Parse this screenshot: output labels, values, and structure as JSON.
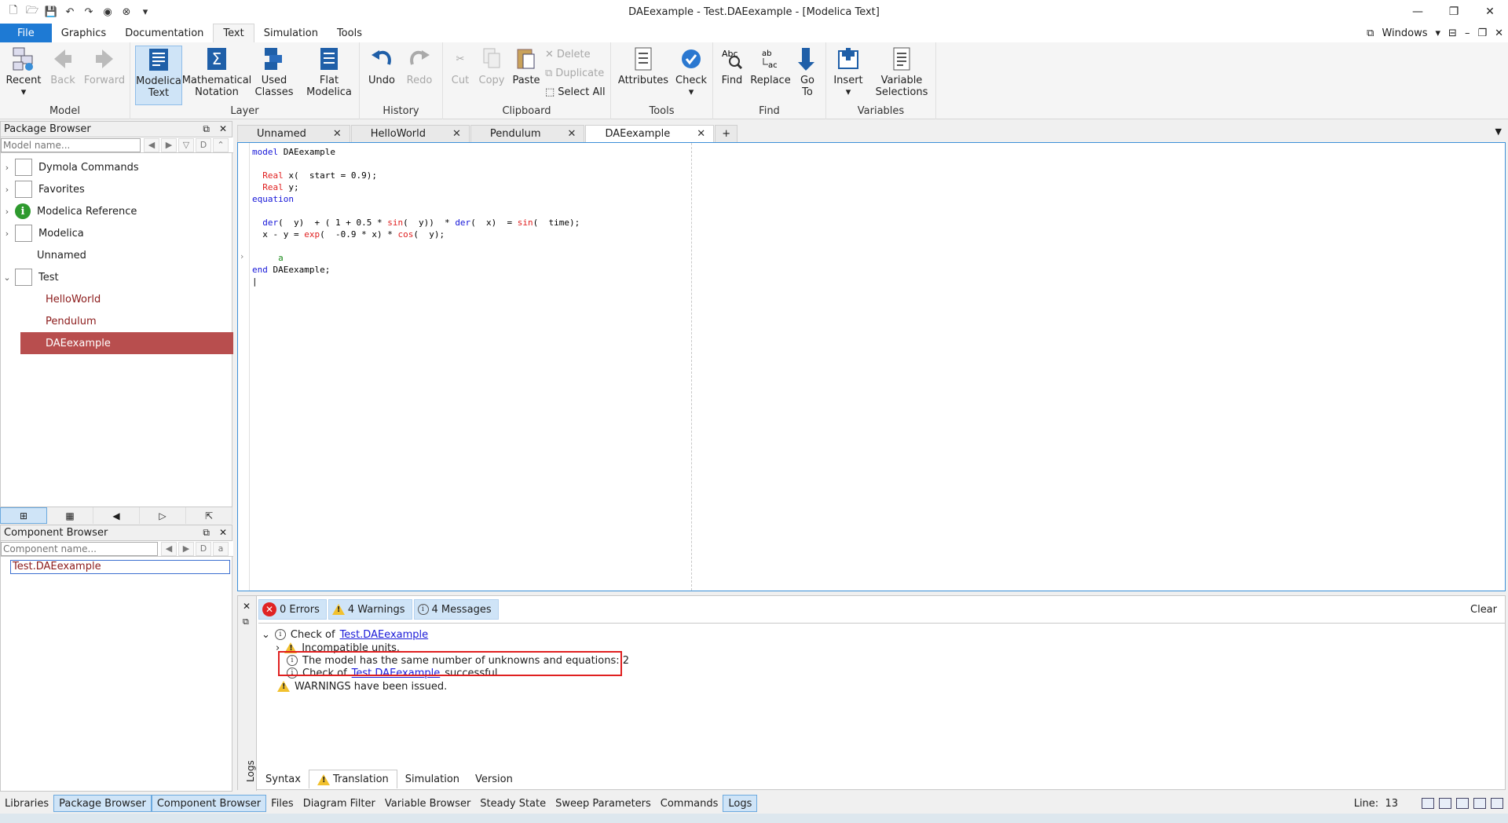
{
  "window": {
    "title": "DAEexample - Test.DAEexample  - [Modelica Text]"
  },
  "ribbon_tabs": [
    "File",
    "Graphics",
    "Documentation",
    "Text",
    "Simulation",
    "Tools"
  ],
  "windows_menu": "Windows",
  "ribbon": {
    "model": {
      "label": "Model",
      "recent": "Recent",
      "back": "Back",
      "forward": "Forward"
    },
    "layer": {
      "label": "Layer",
      "modelica_text": "Modelica\nText",
      "math_notation": "Mathematical\nNotation",
      "used_classes": "Used\nClasses",
      "flat_modelica": "Flat\nModelica"
    },
    "history": {
      "label": "History",
      "undo": "Undo",
      "redo": "Redo"
    },
    "clipboard": {
      "label": "Clipboard",
      "cut": "Cut",
      "copy": "Copy",
      "paste": "Paste",
      "delete": "Delete",
      "duplicate": "Duplicate",
      "select_all": "Select All"
    },
    "tools": {
      "label": "Tools",
      "attributes": "Attributes",
      "check": "Check"
    },
    "find": {
      "label": "Find",
      "find": "Find",
      "replace": "Replace",
      "goto": "Go\nTo"
    },
    "variables": {
      "label": "Variables",
      "insert": "Insert",
      "variable_selections": "Variable\nSelections"
    }
  },
  "package_browser": {
    "title": "Package Browser",
    "search_placeholder": "Model name...",
    "items": [
      {
        "label": "Dymola Commands"
      },
      {
        "label": "Favorites"
      },
      {
        "label": "Modelica Reference"
      },
      {
        "label": "Modelica"
      },
      {
        "label": "Unnamed"
      },
      {
        "label": "Test"
      }
    ],
    "children": [
      "HelloWorld",
      "Pendulum",
      "DAEexample"
    ]
  },
  "component_browser": {
    "title": "Component Browser",
    "search_placeholder": "Component name...",
    "item": "Test.DAEexample"
  },
  "editor_tabs": [
    "Unnamed",
    "HelloWorld",
    "Pendulum",
    "DAEexample"
  ],
  "logs": {
    "errors": "0 Errors",
    "warnings": "4 Warnings",
    "messages": "4 Messages",
    "clear": "Clear",
    "check_prefix": "Check of",
    "model_link": "Test.DAEexample",
    "incompatible": "Incompatible units.",
    "same_number": "The model has the same number of unknowns and equations: 2",
    "successful": "successful.",
    "warnings_issued": "WARNINGS have been issued.",
    "side_label": "Logs",
    "tabs": [
      "Syntax",
      "Translation",
      "Simulation",
      "Version"
    ]
  },
  "statusbar": {
    "items": [
      "Libraries",
      "Package Browser",
      "Component Browser",
      "Files",
      "Diagram Filter",
      "Variable Browser",
      "Steady State",
      "Sweep Parameters",
      "Commands",
      "Logs"
    ],
    "line_label": "Line:",
    "line_value": "13"
  }
}
